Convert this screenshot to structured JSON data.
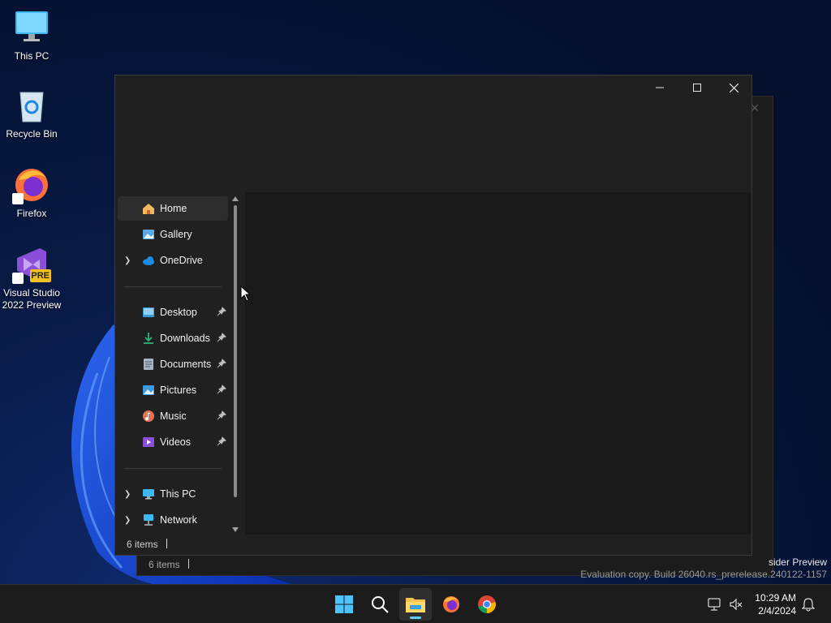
{
  "desktop": {
    "icons": [
      {
        "label": "This PC",
        "icon": "monitor-icon"
      },
      {
        "label": "Recycle Bin",
        "icon": "recycle-bin-icon"
      },
      {
        "label": "Firefox",
        "icon": "firefox-icon"
      },
      {
        "label": "Visual Studio 2022 Preview",
        "icon": "visual-studio-icon",
        "badge": "PRE"
      }
    ]
  },
  "back_window": {
    "status_count": "6 items"
  },
  "explorer": {
    "nav": {
      "items": [
        {
          "label": "Home",
          "icon": "home-icon",
          "selected": true
        },
        {
          "label": "Gallery",
          "icon": "gallery-icon"
        },
        {
          "label": "OneDrive",
          "icon": "onedrive-icon",
          "expandable": true
        },
        {
          "label": "Desktop",
          "icon": "desktop-folder-icon",
          "pinned": true
        },
        {
          "label": "Downloads",
          "icon": "downloads-icon",
          "pinned": true
        },
        {
          "label": "Documents",
          "icon": "documents-icon",
          "pinned": true
        },
        {
          "label": "Pictures",
          "icon": "pictures-icon",
          "pinned": true
        },
        {
          "label": "Music",
          "icon": "music-icon",
          "pinned": true
        },
        {
          "label": "Videos",
          "icon": "videos-icon",
          "pinned": true
        },
        {
          "label": "This PC",
          "icon": "this-pc-icon",
          "expandable": true
        },
        {
          "label": "Network",
          "icon": "network-icon",
          "expandable": true
        }
      ]
    },
    "status": {
      "count": "6 items"
    }
  },
  "watermark": {
    "line1": "sider Preview",
    "line2": "Evaluation copy. Build 26040.rs_prerelease.240122-1157"
  },
  "taskbar": {
    "apps": [
      "start-icon",
      "search-icon",
      "file-explorer-icon",
      "firefox-icon",
      "chrome-icon"
    ],
    "clock": {
      "time": "10:29 AM",
      "date": "2/4/2024"
    }
  },
  "colors": {
    "accent": "#60cdff",
    "window_bg": "#202020",
    "content_bg": "#191919"
  }
}
